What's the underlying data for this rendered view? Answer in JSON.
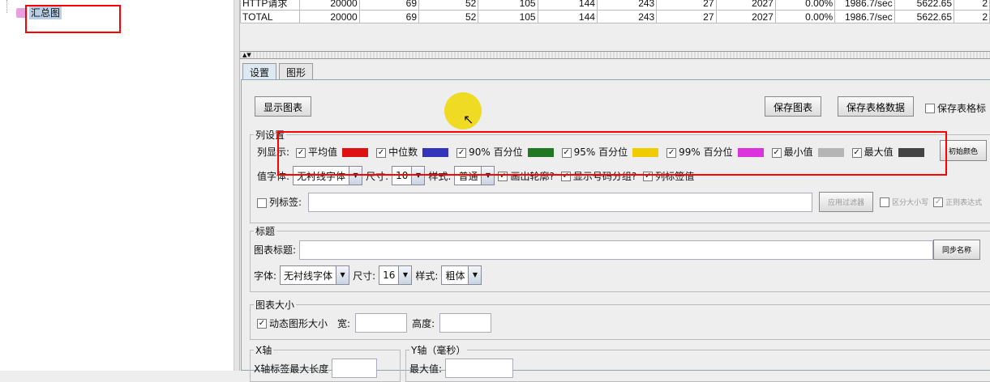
{
  "tree": {
    "items": [
      "汇总图"
    ]
  },
  "table": {
    "rows": [
      [
        "HTTP请求",
        "20000",
        "69",
        "52",
        "105",
        "144",
        "243",
        "27",
        "2027",
        "0.00%",
        "1986.7/sec",
        "5622.65",
        "2"
      ],
      [
        "TOTAL",
        "20000",
        "69",
        "52",
        "105",
        "144",
        "243",
        "27",
        "2027",
        "0.00%",
        "1986.7/sec",
        "5622.65",
        "2"
      ]
    ]
  },
  "tabs": [
    "设置",
    "图形"
  ],
  "toolbar": {
    "display_chart": "显示图表",
    "save_chart": "保存图表",
    "save_table_data": "保存表格数据",
    "save_table_header": "保存表格标"
  },
  "columns": {
    "group": "列设置",
    "display_label": "列显示:",
    "items": [
      {
        "label": "平均值",
        "color": "#dd1111"
      },
      {
        "label": "中位数",
        "color": "#3333bb"
      },
      {
        "label": "90% 百分位",
        "color": "#227722"
      },
      {
        "label": "95% 百分位",
        "color": "#eecc00"
      },
      {
        "label": "99% 百分位",
        "color": "#dd33dd"
      },
      {
        "label": "最小值",
        "color": "#b5b5b5"
      },
      {
        "label": "最大值",
        "color": "#444444"
      }
    ],
    "reset_colors": "初始颜色",
    "value_font_label": "值字体:",
    "value_font": "无衬线字体",
    "size_label": "尺寸:",
    "size": "10",
    "style_label": "样式:",
    "style": "普通",
    "outline": "画出轮廓?",
    "number_grouping": "显示号码分组?",
    "value_labels": "列标签值",
    "col_label": "列标签:",
    "apply_filter": "应用过滤器",
    "case_sensitive": "区分大小写",
    "regex": "正则表达式"
  },
  "title": {
    "group": "标题",
    "chart_title_label": "图表标题:",
    "chart_title": "",
    "sync_name": "同步名称",
    "font_label": "字体:",
    "font": "无衬线字体",
    "size_label": "尺寸:",
    "size": "16",
    "style_label": "样式:",
    "style": "粗体"
  },
  "size": {
    "group": "图表大小",
    "dynamic": "动态图形大小",
    "width_label": "宽:",
    "height_label": "高度:"
  },
  "xaxis": {
    "group": "X轴",
    "max_len_label": "X轴标签最大长度"
  },
  "yaxis": {
    "group": "Y轴（毫秒）",
    "max_label": "最大值:"
  }
}
